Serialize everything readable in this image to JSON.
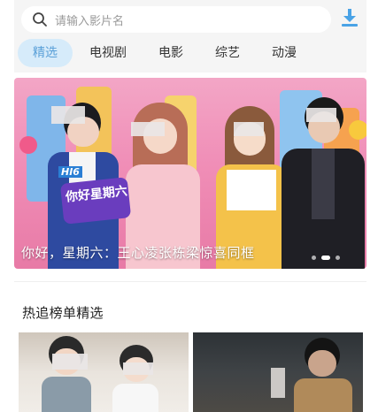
{
  "search": {
    "placeholder": "请输入影片名",
    "icon": "search-icon"
  },
  "download": {
    "icon": "download-icon",
    "color": "#4aa3e6"
  },
  "tabs": [
    {
      "label": "精选",
      "active": true
    },
    {
      "label": "电视剧",
      "active": false
    },
    {
      "label": "电影",
      "active": false
    },
    {
      "label": "综艺",
      "active": false
    },
    {
      "label": "动漫",
      "active": false
    }
  ],
  "banner": {
    "caption": "你好，星期六：王心凌张栋梁惊喜同框",
    "logo_text": "你好星期六",
    "logo_channel": "HI6",
    "slide_count": 3,
    "active_slide": 2
  },
  "section": {
    "title": "热追榜单精选"
  },
  "colors": {
    "accent": "#5aa0d8",
    "tab_active_bg": "#d6ebfa",
    "page_bg": "#f5f5f5"
  }
}
